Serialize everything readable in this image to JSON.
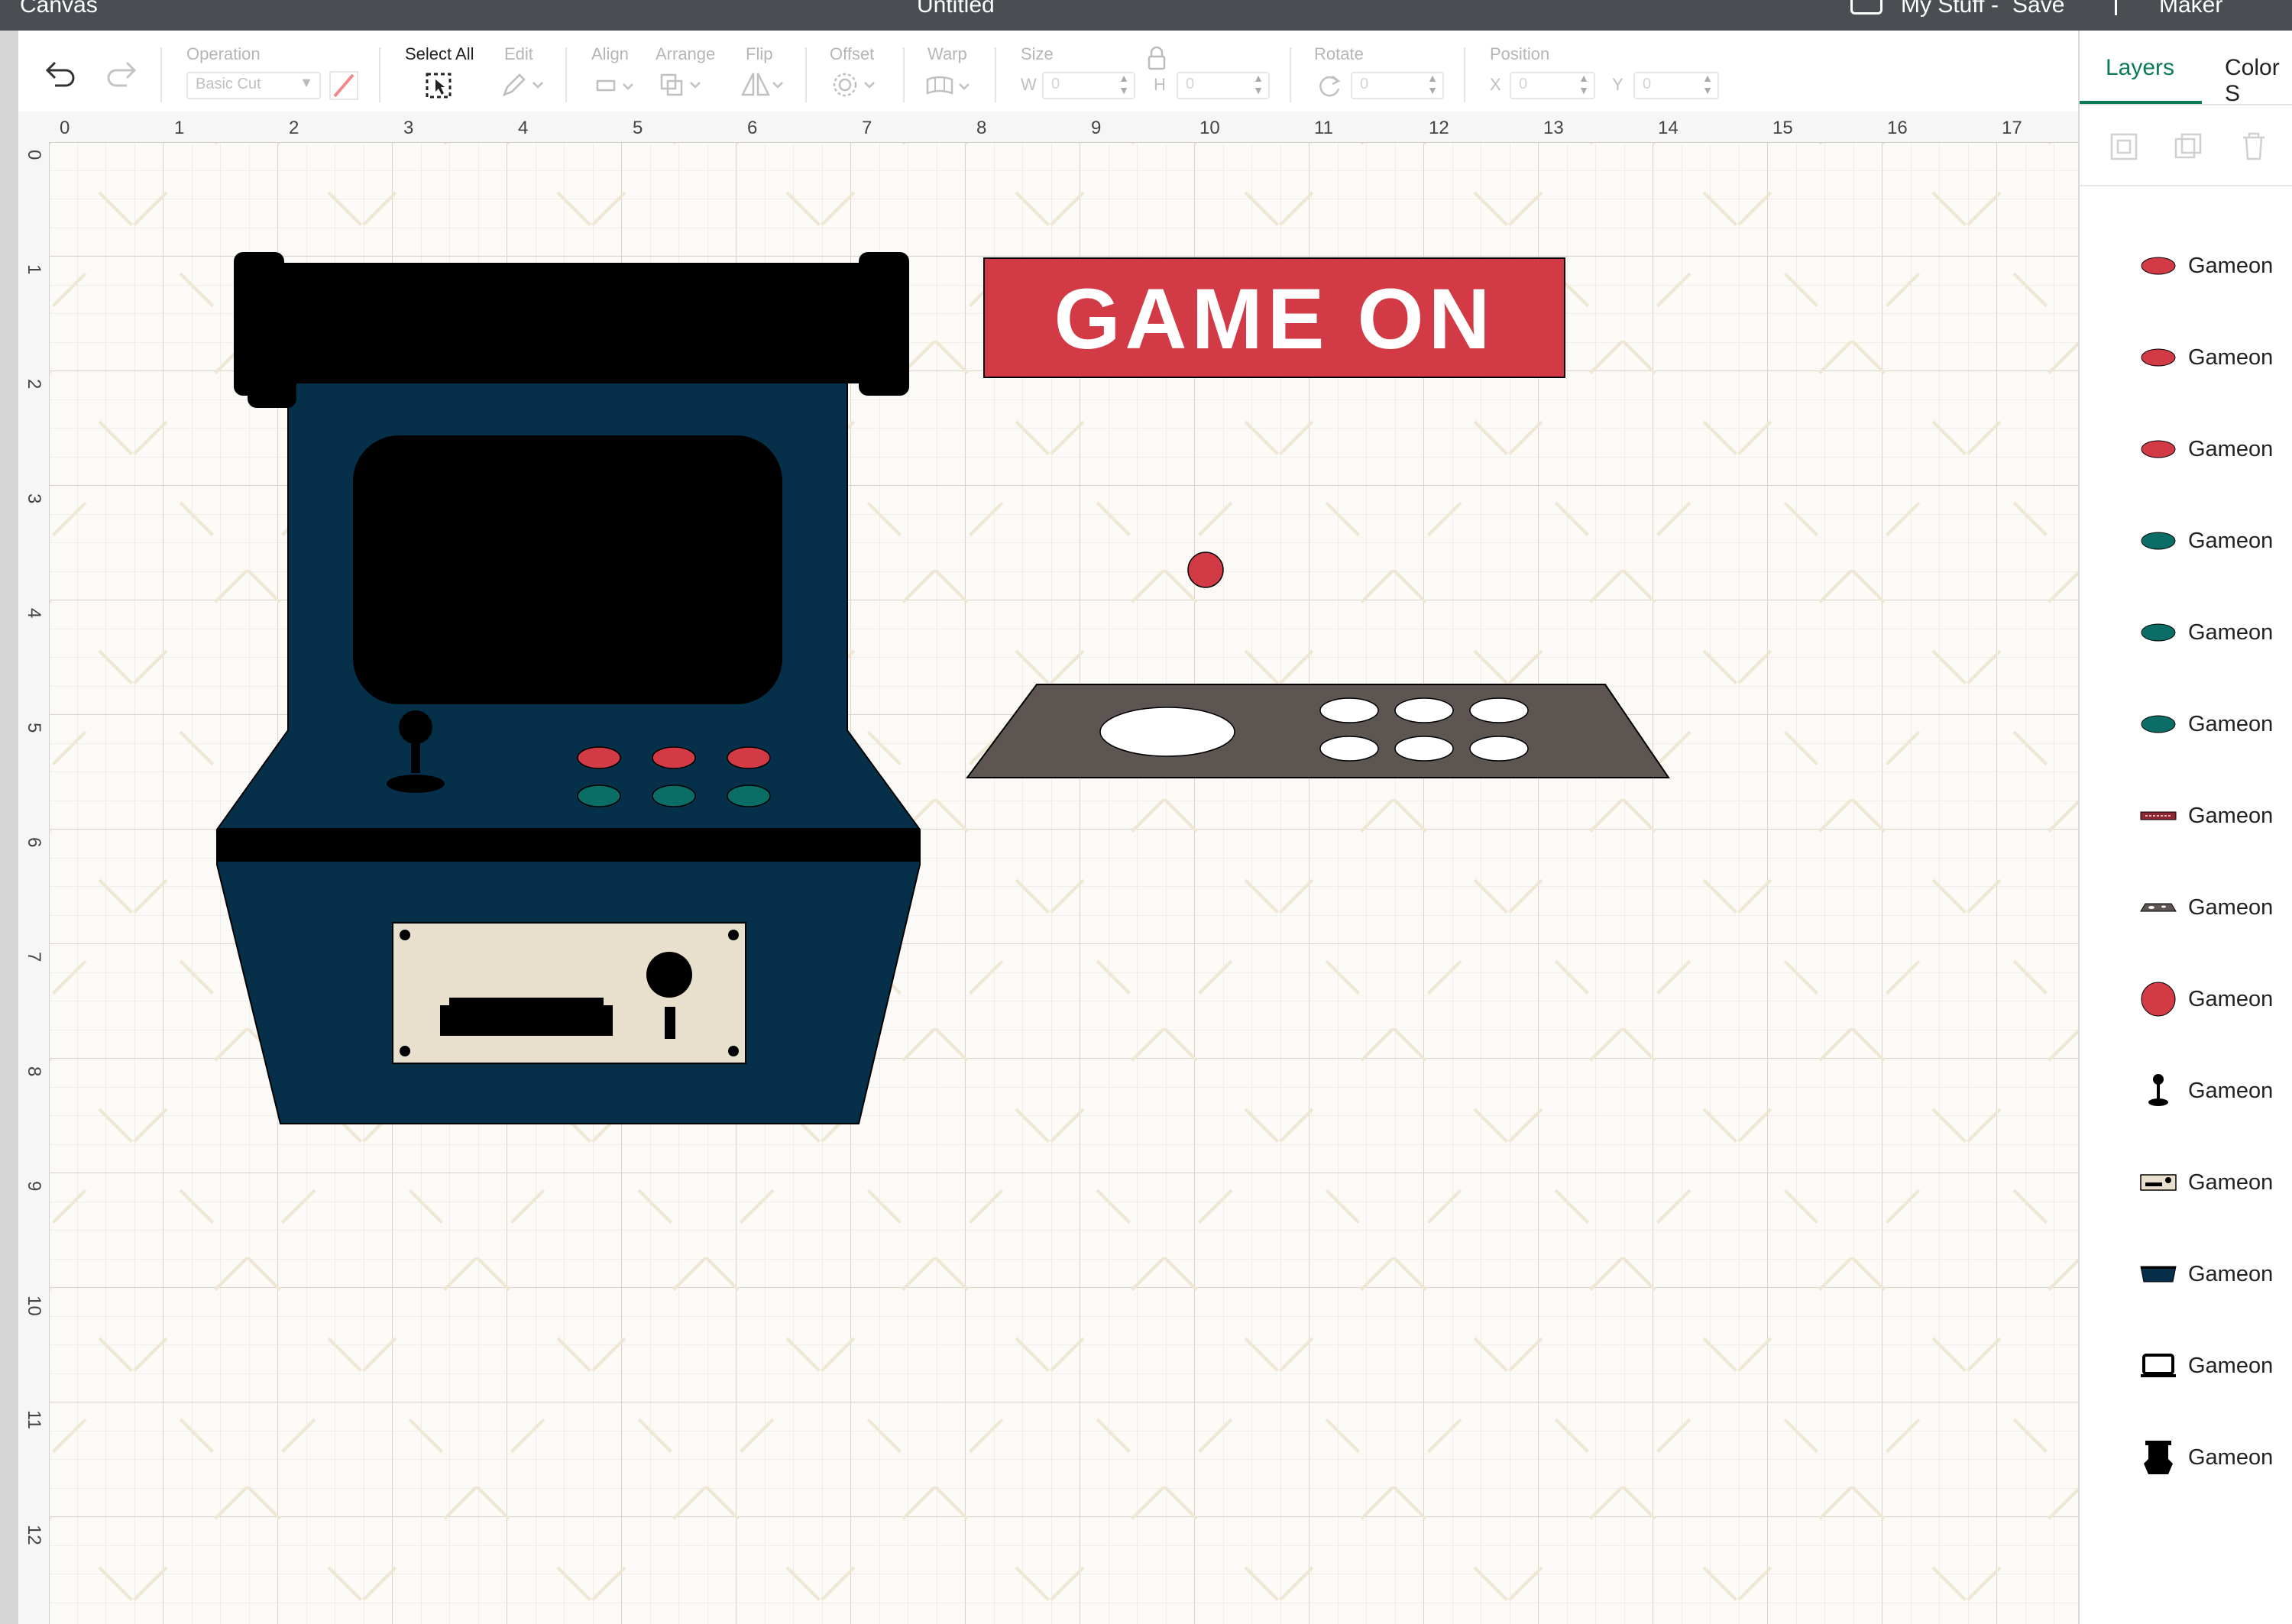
{
  "topbar": {
    "left_title": "Canvas",
    "center_title": "Untitled",
    "project_link": "My Stuff",
    "save_label": "Save",
    "machine_label": "Maker"
  },
  "toolbar": {
    "operation_label": "Operation",
    "operation_value": "Basic Cut",
    "select_all_label": "Select All",
    "edit_label": "Edit",
    "align_label": "Align",
    "arrange_label": "Arrange",
    "flip_label": "Flip",
    "offset_label": "Offset",
    "warp_label": "Warp",
    "size_label": "Size",
    "size_w_prefix": "W",
    "size_w_value": "0",
    "size_h_prefix": "H",
    "size_h_value": "0",
    "rotate_label": "Rotate",
    "rotate_value": "0",
    "position_label": "Position",
    "position_x_prefix": "X",
    "position_x_value": "0",
    "position_y_prefix": "Y",
    "position_y_value": "0"
  },
  "ruler": {
    "h": [
      "0",
      "1",
      "2",
      "3",
      "4",
      "5",
      "6",
      "7",
      "8",
      "9",
      "10",
      "11",
      "12",
      "13",
      "14",
      "15",
      "16",
      "17"
    ],
    "v": [
      "0",
      "1",
      "2",
      "3",
      "4",
      "5",
      "6",
      "7",
      "8",
      "9",
      "10",
      "11",
      "12"
    ]
  },
  "canvas": {
    "sign_text": "GAME ON"
  },
  "panel": {
    "tabs": [
      "Layers",
      "Color S"
    ],
    "layers": [
      {
        "label": "Gameon",
        "icon": "red-oval-icon",
        "color": "#d23a45"
      },
      {
        "label": "Gameon",
        "icon": "red-oval-icon",
        "color": "#d23a45"
      },
      {
        "label": "Gameon",
        "icon": "red-oval-icon",
        "color": "#d23a45"
      },
      {
        "label": "Gameon",
        "icon": "teal-oval-icon",
        "color": "#0b6e66"
      },
      {
        "label": "Gameon",
        "icon": "teal-oval-icon",
        "color": "#0b6e66"
      },
      {
        "label": "Gameon",
        "icon": "teal-oval-icon",
        "color": "#0b6e66"
      },
      {
        "label": "Gameon",
        "icon": "sign-strip-icon",
        "color": "#8c2630"
      },
      {
        "label": "Gameon",
        "icon": "control-panel-icon",
        "color": "#5d5552"
      },
      {
        "label": "Gameon",
        "icon": "red-circle-icon",
        "color": "#d23a45"
      },
      {
        "label": "Gameon",
        "icon": "joystick-icon",
        "color": "#000000"
      },
      {
        "label": "Gameon",
        "icon": "coin-plate-icon",
        "color": "#e9dfcd"
      },
      {
        "label": "Gameon",
        "icon": "cabinet-base-icon",
        "color": "#06304a"
      },
      {
        "label": "Gameon",
        "icon": "screen-frame-icon",
        "color": "#000000"
      },
      {
        "label": "Gameon",
        "icon": "cabinet-silhouette-icon",
        "color": "#000000"
      }
    ]
  },
  "colors": {
    "accent": "#0b7a55",
    "cabinet": "#06304a",
    "red": "#d23a45",
    "teal": "#0b6e66",
    "panel_gray": "#5d5552",
    "plate": "#e9dfcd"
  }
}
